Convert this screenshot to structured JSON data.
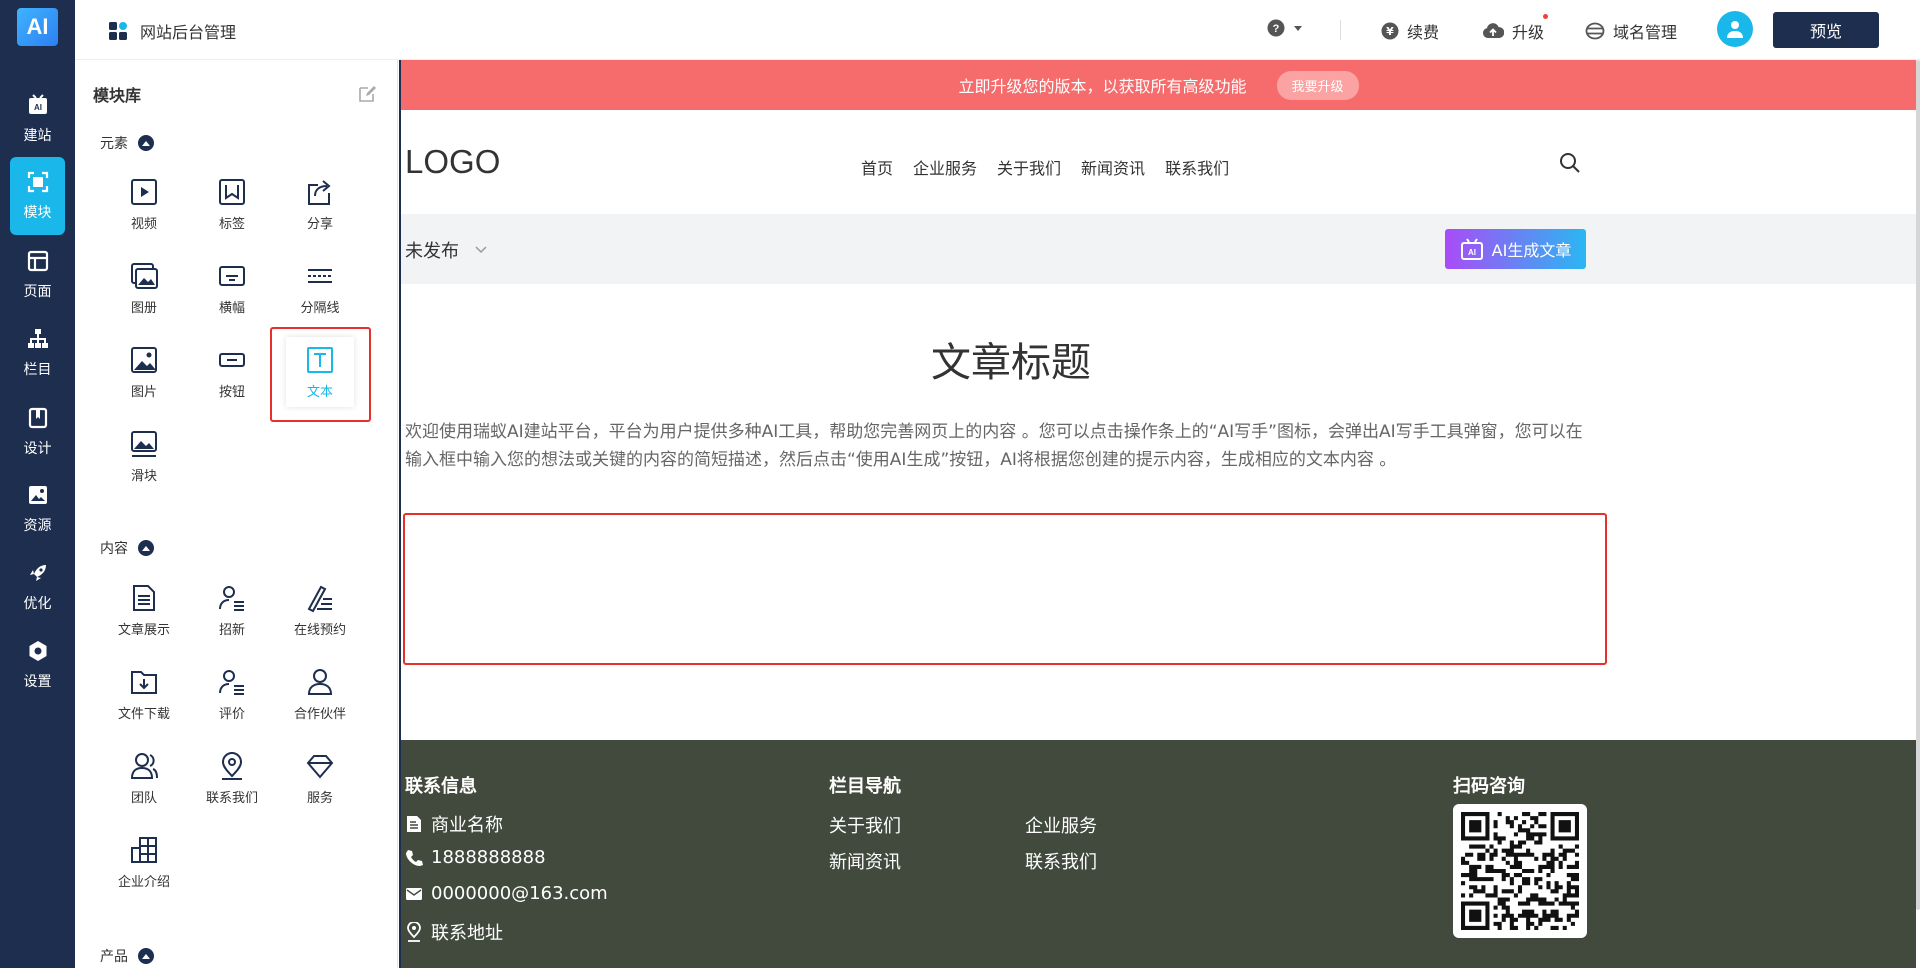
{
  "rail": {
    "logo": "AI",
    "items": [
      {
        "label": "建站",
        "icon": "ai-build-icon"
      },
      {
        "label": "模块",
        "icon": "module-icon"
      },
      {
        "label": "页面",
        "icon": "page-icon"
      },
      {
        "label": "栏目",
        "icon": "sitemap-icon"
      },
      {
        "label": "设计",
        "icon": "design-icon"
      },
      {
        "label": "资源",
        "icon": "resource-icon"
      },
      {
        "label": "优化",
        "icon": "rocket-icon"
      },
      {
        "label": "设置",
        "icon": "settings-icon"
      }
    ],
    "active_index": 1
  },
  "panel": {
    "title": "模块库",
    "sections": {
      "elements": "元素",
      "content": "内容",
      "products": "产品"
    },
    "element_modules": [
      "视频",
      "标签",
      "分享",
      "图册",
      "横幅",
      "分隔线",
      "图片",
      "按钮",
      "文本",
      "滑块"
    ],
    "content_modules": [
      "文章展示",
      "招新",
      "在线预约",
      "文件下载",
      "评价",
      "合作伙伴",
      "团队",
      "联系我们",
      "服务",
      "企业介绍"
    ]
  },
  "topbar": {
    "title": "网站后台管理",
    "renew": "续费",
    "upgrade": "升级",
    "domain": "域名管理",
    "preview": "预览"
  },
  "canvas": {
    "banner_text": "立即升级您的版本，以获取所有高级功能",
    "banner_button": "我要升级",
    "logo": "LOGO",
    "nav": [
      "首页",
      "企业服务",
      "关于我们",
      "新闻资讯",
      "联系我们"
    ],
    "status": "未发布",
    "ai_button": "AI生成文章",
    "article_title": "文章标题",
    "article_body": "欢迎使用瑞蚁AI建站平台，平台为用户提供多种AI工具，帮助您完善网页上的内容 。您可以点击操作条上的“AI写手”图标，会弹出AI写手工具弹窗，您可以在输入框中输入您的想法或关键的内容的简短描述，然后点击“使用AI生成”按钮，AI将根据您创建的提示内容，生成相应的文本内容 。"
  },
  "footer": {
    "contact_head": "联系信息",
    "company": "商业名称",
    "phone": "1888888888",
    "email": "0000000@163.com",
    "address": "联系地址",
    "nav_head": "栏目导航",
    "links": [
      "关于我们",
      "企业服务",
      "新闻资讯",
      "联系我们"
    ],
    "qr_head": "扫码咨询"
  },
  "colors": {
    "rail_bg": "#1e2e4f",
    "accent": "#1ab7ea",
    "banner": "#f66b6b",
    "footer_bg": "#424a3d",
    "highlight_red": "#e8302a"
  }
}
